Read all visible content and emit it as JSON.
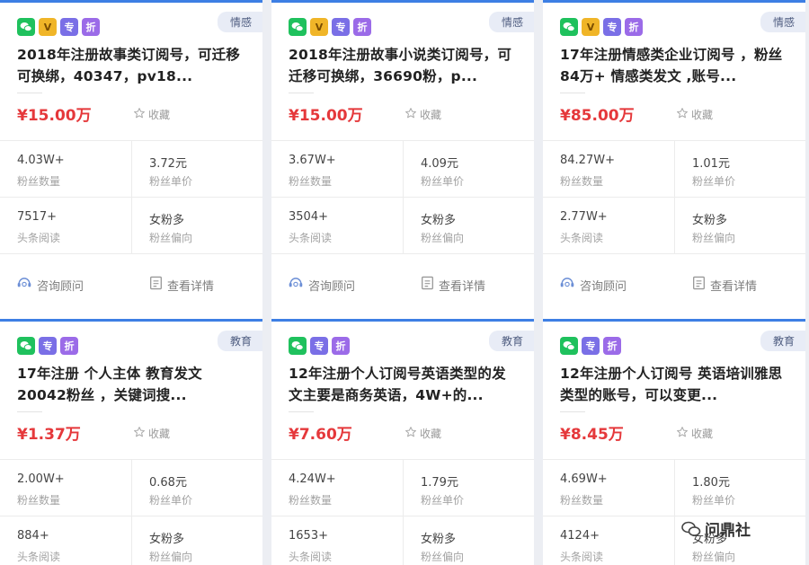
{
  "cards": [
    {
      "badges": [
        "wechat",
        "v",
        "zhuan",
        "zhe"
      ],
      "category": "情感",
      "title": "2018年注册故事类订阅号，可迁移可换绑，40347，pv18...",
      "price": "¥15.00万",
      "favorite_label": "收藏",
      "stats": [
        {
          "value": "4.03W+",
          "label": "粉丝数量"
        },
        {
          "value": "3.72元",
          "label": "粉丝单价"
        },
        {
          "value": "7517+",
          "label": "头条阅读"
        },
        {
          "value": "女粉多",
          "label": "粉丝偏向"
        }
      ],
      "consult_label": "咨询顾问",
      "detail_label": "查看详情"
    },
    {
      "badges": [
        "wechat",
        "v",
        "zhuan",
        "zhe"
      ],
      "category": "情感",
      "title": "2018年注册故事小说类订阅号，可迁移可换绑，36690粉，p...",
      "price": "¥15.00万",
      "favorite_label": "收藏",
      "stats": [
        {
          "value": "3.67W+",
          "label": "粉丝数量"
        },
        {
          "value": "4.09元",
          "label": "粉丝单价"
        },
        {
          "value": "3504+",
          "label": "头条阅读"
        },
        {
          "value": "女粉多",
          "label": "粉丝偏向"
        }
      ],
      "consult_label": "咨询顾问",
      "detail_label": "查看详情"
    },
    {
      "badges": [
        "wechat",
        "v",
        "zhuan",
        "zhe"
      ],
      "category": "情感",
      "title": "17年注册情感类企业订阅号 ，粉丝84万+ 情感类发文 ,账号...",
      "price": "¥85.00万",
      "favorite_label": "收藏",
      "stats": [
        {
          "value": "84.27W+",
          "label": "粉丝数量"
        },
        {
          "value": "1.01元",
          "label": "粉丝单价"
        },
        {
          "value": "2.77W+",
          "label": "头条阅读"
        },
        {
          "value": "女粉多",
          "label": "粉丝偏向"
        }
      ],
      "consult_label": "咨询顾问",
      "detail_label": "查看详情"
    },
    {
      "badges": [
        "wechat",
        "zhuan",
        "zhe"
      ],
      "category": "教育",
      "title": "17年注册 个人主体 教育发文 20042粉丝 ，关键词搜...",
      "price": "¥1.37万",
      "favorite_label": "收藏",
      "stats": [
        {
          "value": "2.00W+",
          "label": "粉丝数量"
        },
        {
          "value": "0.68元",
          "label": "粉丝单价"
        },
        {
          "value": "884+",
          "label": "头条阅读"
        },
        {
          "value": "女粉多",
          "label": "粉丝偏向"
        }
      ],
      "consult_label": "",
      "detail_label": ""
    },
    {
      "badges": [
        "wechat",
        "zhuan",
        "zhe"
      ],
      "category": "教育",
      "title": "12年注册个人订阅号英语类型的发文主要是商务英语，4W+的...",
      "price": "¥7.60万",
      "favorite_label": "收藏",
      "stats": [
        {
          "value": "4.24W+",
          "label": "粉丝数量"
        },
        {
          "value": "1.79元",
          "label": "粉丝单价"
        },
        {
          "value": "1653+",
          "label": "头条阅读"
        },
        {
          "value": "女粉多",
          "label": "粉丝偏向"
        }
      ],
      "consult_label": "",
      "detail_label": ""
    },
    {
      "badges": [
        "wechat",
        "zhuan",
        "zhe"
      ],
      "category": "教育",
      "title": "12年注册个人订阅号 英语培训雅思类型的账号，可以变更...",
      "price": "¥8.45万",
      "favorite_label": "收藏",
      "stats": [
        {
          "value": "4.69W+",
          "label": "粉丝数量"
        },
        {
          "value": "1.80元",
          "label": "粉丝单价"
        },
        {
          "value": "4124+",
          "label": "头条阅读"
        },
        {
          "value": "女粉多",
          "label": "粉丝偏向"
        }
      ],
      "consult_label": "",
      "detail_label": ""
    }
  ],
  "badge_text": {
    "v": "V",
    "zhuan": "专",
    "zhe": "折"
  },
  "watermark": {
    "text": "问鼎社"
  },
  "colors": {
    "accent": "#3d7fe4",
    "price": "#e5383b",
    "wechat": "#1fc15d"
  }
}
